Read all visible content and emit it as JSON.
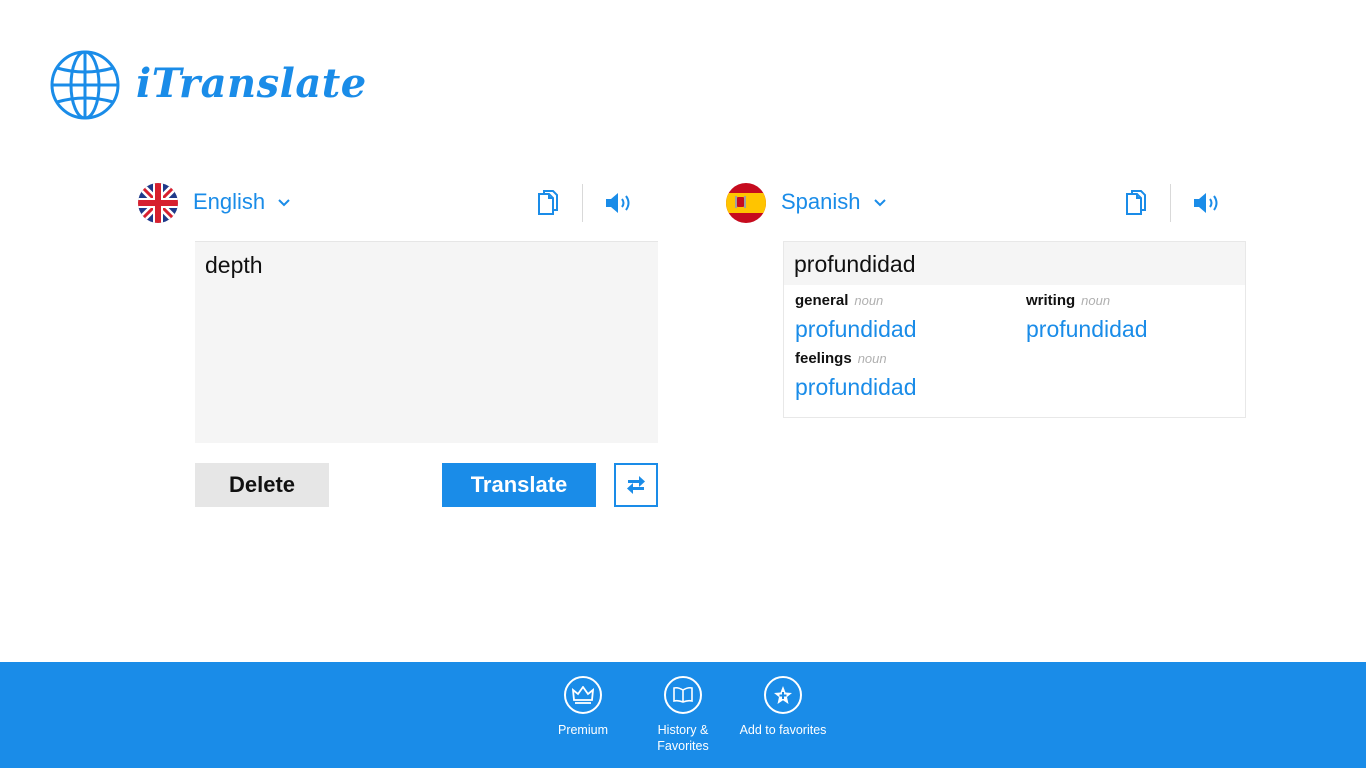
{
  "app": {
    "title": "iTranslate"
  },
  "colors": {
    "accent": "#1a8ce8",
    "panel": "#f5f5f5",
    "delete_bg": "#e6e6e6"
  },
  "source": {
    "language": "English",
    "flag_icon": "uk-flag-icon",
    "text": "depth",
    "copy_icon": "copy-icon",
    "speak_icon": "speaker-icon"
  },
  "target": {
    "language": "Spanish",
    "flag_icon": "spain-flag-icon",
    "main_translation": "profundidad",
    "copy_icon": "copy-icon",
    "speak_icon": "speaker-icon",
    "categories": [
      {
        "title": "general",
        "pos": "noun",
        "translation": "profundidad"
      },
      {
        "title": "writing",
        "pos": "noun",
        "translation": "profundidad"
      },
      {
        "title": "feelings",
        "pos": "noun",
        "translation": "profundidad"
      }
    ]
  },
  "actions": {
    "delete_label": "Delete",
    "translate_label": "Translate",
    "swap_icon": "swap-arrows-icon"
  },
  "app_bar": {
    "items": [
      {
        "label": "Premium",
        "icon": "crown-icon"
      },
      {
        "label": "History  &\nFavorites",
        "icon": "book-icon"
      },
      {
        "label": "Add to favorites",
        "icon": "star-plus-icon"
      }
    ]
  }
}
